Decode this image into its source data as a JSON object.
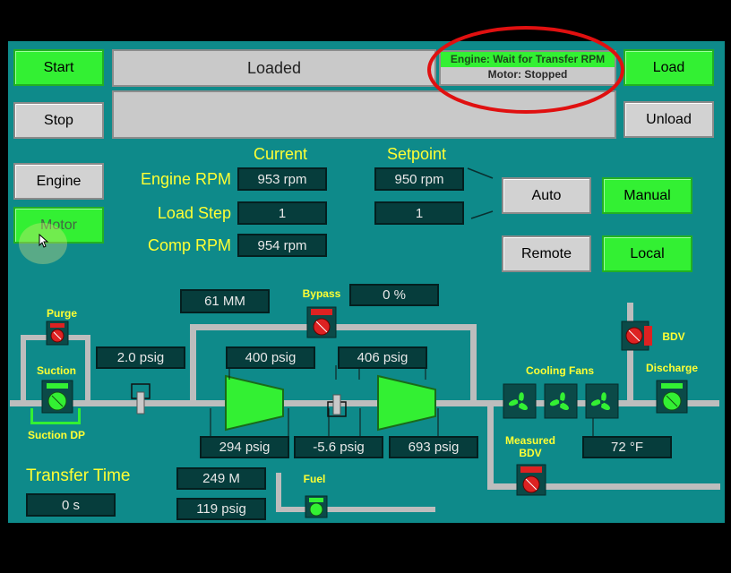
{
  "buttons": {
    "start": "Start",
    "stop": "Stop",
    "load": "Load",
    "unload": "Unload",
    "engine": "Engine",
    "motor": "Motor",
    "auto": "Auto",
    "manual": "Manual",
    "remote": "Remote",
    "local": "Local"
  },
  "status": {
    "main": "Loaded",
    "engine_line": "Engine: Wait for Transfer RPM",
    "motor_line": "Motor: Stopped"
  },
  "headers": {
    "current": "Current",
    "setpoint": "Setpoint"
  },
  "params": {
    "engine_rpm_label": "Engine RPM",
    "engine_rpm_current": "953 rpm",
    "engine_rpm_setpoint": "950 rpm",
    "load_step_label": "Load Step",
    "load_step_current": "1",
    "load_step_setpoint": "1",
    "comp_rpm_label": "Comp RPM",
    "comp_rpm_current": "954 rpm"
  },
  "process": {
    "mm": "61 MM",
    "bypass_label": "Bypass",
    "bypass_value": "0 %",
    "purge_label": "Purge",
    "suction_label": "Suction",
    "suction_dp_label": "Suction DP",
    "suction_psig": "2.0 psig",
    "stage1_discharge": "400 psig",
    "stage2_suction": "406 psig",
    "p_294": "294 psig",
    "p_neg": "-5.6 psig",
    "p_693": "693 psig",
    "cooling_fans_label": "Cooling Fans",
    "bdv_label": "BDV",
    "discharge_label": "Discharge",
    "measured_bdv_label": "Measured\nBDV",
    "temp": "72 °F",
    "fuel_label": "Fuel",
    "fuel_flow": "249 M",
    "fuel_pressure": "119 psig"
  },
  "transfer": {
    "label": "Transfer Time",
    "value": "0 s"
  },
  "colors": {
    "panel": "#0e8a8a",
    "active_green": "#33f033",
    "inactive_grey": "#d2d2d2",
    "label_yellow": "#ffff33",
    "value_bg": "#063d3c",
    "valve_red": "#dd2222",
    "highlight_circle": "#e01010"
  }
}
